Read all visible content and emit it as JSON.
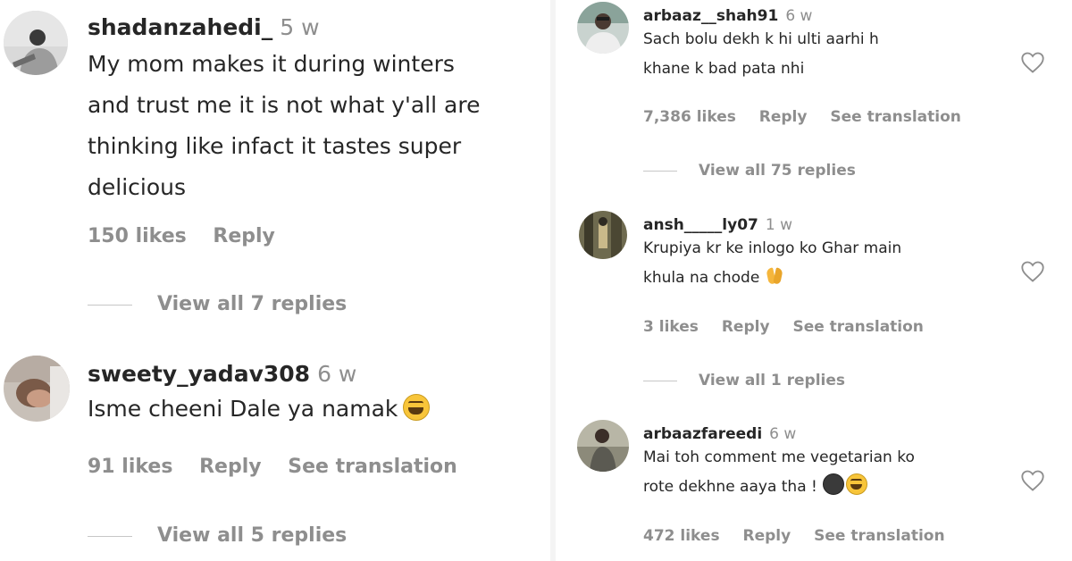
{
  "left": {
    "comments": [
      {
        "username": "shadanzahedi_",
        "time": "5 w",
        "lines": [
          "My mom makes it during winters",
          "and trust me it is not what y'all are",
          "thinking like infact it tastes super",
          "delicious"
        ],
        "likes": "150 likes",
        "reply": "Reply",
        "view_replies": "View all 7 replies"
      },
      {
        "username": "sweety_yadav308",
        "time": "6 w",
        "lines": [
          "Isme cheeni Dale ya namak"
        ],
        "emoji": "face-with-tears-of-joy",
        "likes": "91 likes",
        "reply": "Reply",
        "translation": "See translation",
        "view_replies": "View all 5 replies"
      }
    ]
  },
  "right": {
    "comments": [
      {
        "username": "arbaaz__shah91",
        "time": "6 w",
        "lines": [
          "Sach bolu dekh k hi ulti aarhi h",
          "khane k bad pata nhi"
        ],
        "likes": "7,386 likes",
        "reply": "Reply",
        "translation": "See translation",
        "view_replies": "View all 75 replies"
      },
      {
        "username": "ansh_____ly07",
        "time": "1 w",
        "lines": [
          "Krupiya kr ke inlogo ko Ghar main",
          "khula na chode"
        ],
        "emoji": "folded-hands",
        "likes": "3 likes",
        "reply": "Reply",
        "translation": "See translation",
        "view_replies": "View all 1 replies"
      },
      {
        "username": "arbaazfareedi",
        "time": "6 w",
        "lines": [
          "Mai toh comment me vegetarian ko",
          "rote dekhne aaya tha !"
        ],
        "emoji": "new-moon-face + face-with-tears-of-joy",
        "likes": "472 likes",
        "reply": "Reply",
        "translation": "See translation"
      }
    ]
  },
  "colors": {
    "text": "#262626",
    "secondary": "#8e8e8e",
    "divider": "#c7c7c7",
    "heart_outline": "#8e8e8e"
  },
  "icons": [
    "heart-icon",
    "avatar-image",
    "tears-of-joy-emoji",
    "folded-hands-emoji",
    "new-moon-face-emoji"
  ]
}
